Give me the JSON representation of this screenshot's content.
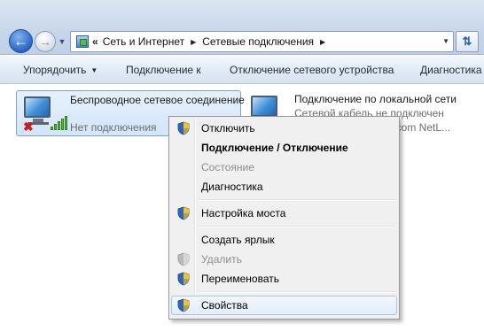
{
  "address": {
    "chevrons": "«",
    "crumbs": [
      "Сеть и Интернет",
      "Сетевые подключения"
    ]
  },
  "toolbar": {
    "organize": "Упорядочить",
    "connect_to": "Подключение к",
    "disable_device": "Отключение сетевого устройства",
    "diagnostics": "Диагностика"
  },
  "connections": [
    {
      "name": "Беспроводное сетевое соединение",
      "status": "Нет подключения",
      "icon": "wireless-network-icon",
      "selected": true
    },
    {
      "name": "Подключение по локальной сети",
      "status_lines": [
        "Сетевой кабель не подключен",
        "...dcom NetL..."
      ],
      "icon": "lan-network-icon"
    }
  ],
  "context_menu": {
    "items": [
      {
        "label": "Отключить",
        "shield": true
      },
      {
        "label": "Подключение / Отключение",
        "bold": true
      },
      {
        "label": "Состояние",
        "disabled": true
      },
      {
        "label": "Диагностика"
      },
      {
        "label": "Настройка моста",
        "shield": true
      },
      {
        "label": "Создать ярлык"
      },
      {
        "label": "Удалить",
        "shield": true,
        "disabled": true
      },
      {
        "label": "Переименовать",
        "shield": true
      },
      {
        "label": "Свойства",
        "shield": true,
        "hover": true
      }
    ]
  },
  "colors": {
    "accent": "#2a66c7",
    "selection": "#d2e5fa",
    "disabled_text": "#8d8d8d"
  }
}
